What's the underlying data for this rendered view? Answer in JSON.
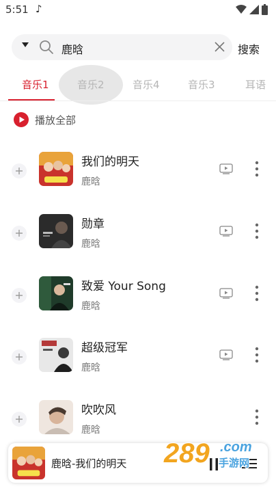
{
  "status_bar": {
    "time": "5:51",
    "note_icon": "music-note-icon"
  },
  "search": {
    "query": "鹿晗",
    "button_label": "搜索"
  },
  "tabs": [
    {
      "label": "音乐1",
      "active": true
    },
    {
      "label": "音乐2",
      "active": false
    },
    {
      "label": "音乐4",
      "active": false
    },
    {
      "label": "音乐3",
      "active": false
    },
    {
      "label": "耳语",
      "active": false
    }
  ],
  "play_all": {
    "label": "播放全部"
  },
  "songs": [
    {
      "title": "我们的明天",
      "artist": "鹿晗",
      "has_mv": true
    },
    {
      "title": "勋章",
      "artist": "鹿晗",
      "has_mv": true
    },
    {
      "title": "致爱 Your Song",
      "artist": "鹿晗",
      "has_mv": true
    },
    {
      "title": "超级冠军",
      "artist": "鹿晗",
      "has_mv": true
    },
    {
      "title": "吹吹风",
      "artist": "鹿晗",
      "has_mv": false
    }
  ],
  "now_playing": {
    "text": "鹿晗-我们的明天"
  },
  "watermark": {
    "text": "289",
    "sub": "手游网",
    "suffix": ".com"
  },
  "colors": {
    "accent": "#d8202e",
    "muted_tab": "#b5b5b5"
  }
}
